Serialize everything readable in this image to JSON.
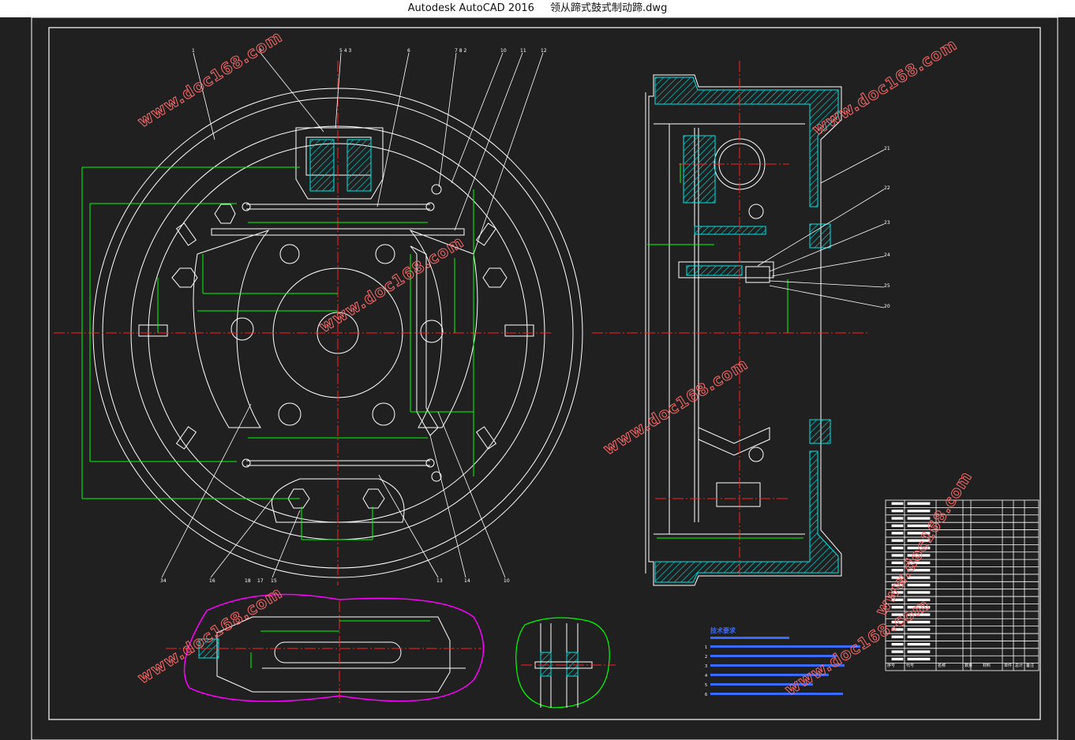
{
  "window": {
    "app_title": "Autodesk AutoCAD 2016",
    "document_name": "领从蹄式鼓式制动蹄.dwg"
  },
  "drawing": {
    "watermark": "www.doc168.com",
    "colors": {
      "background": "#202020",
      "lines": "#ffffff",
      "dimension": "#00ff00",
      "centerline": "#ff2020",
      "hatch": "#00e5e5",
      "leader": "#ffffff",
      "outline_magenta": "#ff00ff",
      "watermark": "#ff6a6a",
      "notes": "#3a6bff"
    },
    "top_labels": [
      "1",
      "9",
      "5 4 3",
      "6",
      "7 8 2",
      "10",
      "11",
      "12"
    ],
    "bottom_labels": [
      "34",
      "16",
      "18",
      "17",
      "15",
      "13",
      "14",
      "10"
    ],
    "side_labels": [
      "21",
      "22",
      "23",
      "24",
      "25",
      "20"
    ],
    "notes_title": "技术要求",
    "notes_lines": [
      "1",
      "2",
      "3",
      "4",
      "5",
      "6"
    ],
    "bom_headers": [
      "序号",
      "代号",
      "名称",
      "数量",
      "材料",
      "单件",
      "总计",
      "备注"
    ],
    "bom_row_count": 22
  }
}
